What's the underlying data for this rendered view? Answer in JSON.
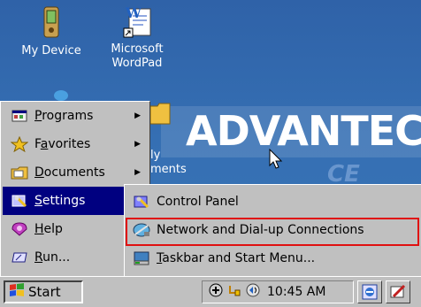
{
  "desktop": {
    "icons": [
      {
        "label": "My Device",
        "icon": "pda-icon"
      },
      {
        "label_line1": "Microsoft",
        "label_line2": "WordPad",
        "icon": "wordpad-icon"
      }
    ],
    "banner": {
      "brand": "ADVANTECH",
      "watermark": "CE"
    },
    "partial_text_1": "ly",
    "partial_text_2": "ments"
  },
  "start_menu": {
    "items": [
      {
        "label": "Programs",
        "accel": "P",
        "icon": "programs-icon",
        "has_submenu": true
      },
      {
        "label": "Favorites",
        "accel": "a",
        "icon": "favorites-icon",
        "has_submenu": true
      },
      {
        "label": "Documents",
        "accel": "D",
        "icon": "documents-icon",
        "has_submenu": true
      },
      {
        "label": "Settings",
        "accel": "S",
        "icon": "settings-icon",
        "has_submenu": true,
        "selected": true
      },
      {
        "label": "Help",
        "accel": "H",
        "icon": "help-icon",
        "has_submenu": false
      },
      {
        "label": "Run...",
        "accel": "R",
        "icon": "run-icon",
        "has_submenu": false
      }
    ]
  },
  "settings_submenu": {
    "items": [
      {
        "label": "Control Panel",
        "icon": "control-panel-icon"
      },
      {
        "label": "Network and Dial-up Connections",
        "icon": "network-icon"
      },
      {
        "label": "Taskbar and Start Menu...",
        "icon": "taskbar-icon"
      }
    ]
  },
  "taskbar": {
    "start_label": "Start",
    "clock": "10:45 AM",
    "tray_icons": [
      "network-status-icon",
      "usb-icon",
      "volume-icon"
    ]
  },
  "colors": {
    "desktop": "#356fb3",
    "selection": "#000080",
    "menu_bg": "#c0c0c0",
    "highlight_box": "#e01010"
  }
}
